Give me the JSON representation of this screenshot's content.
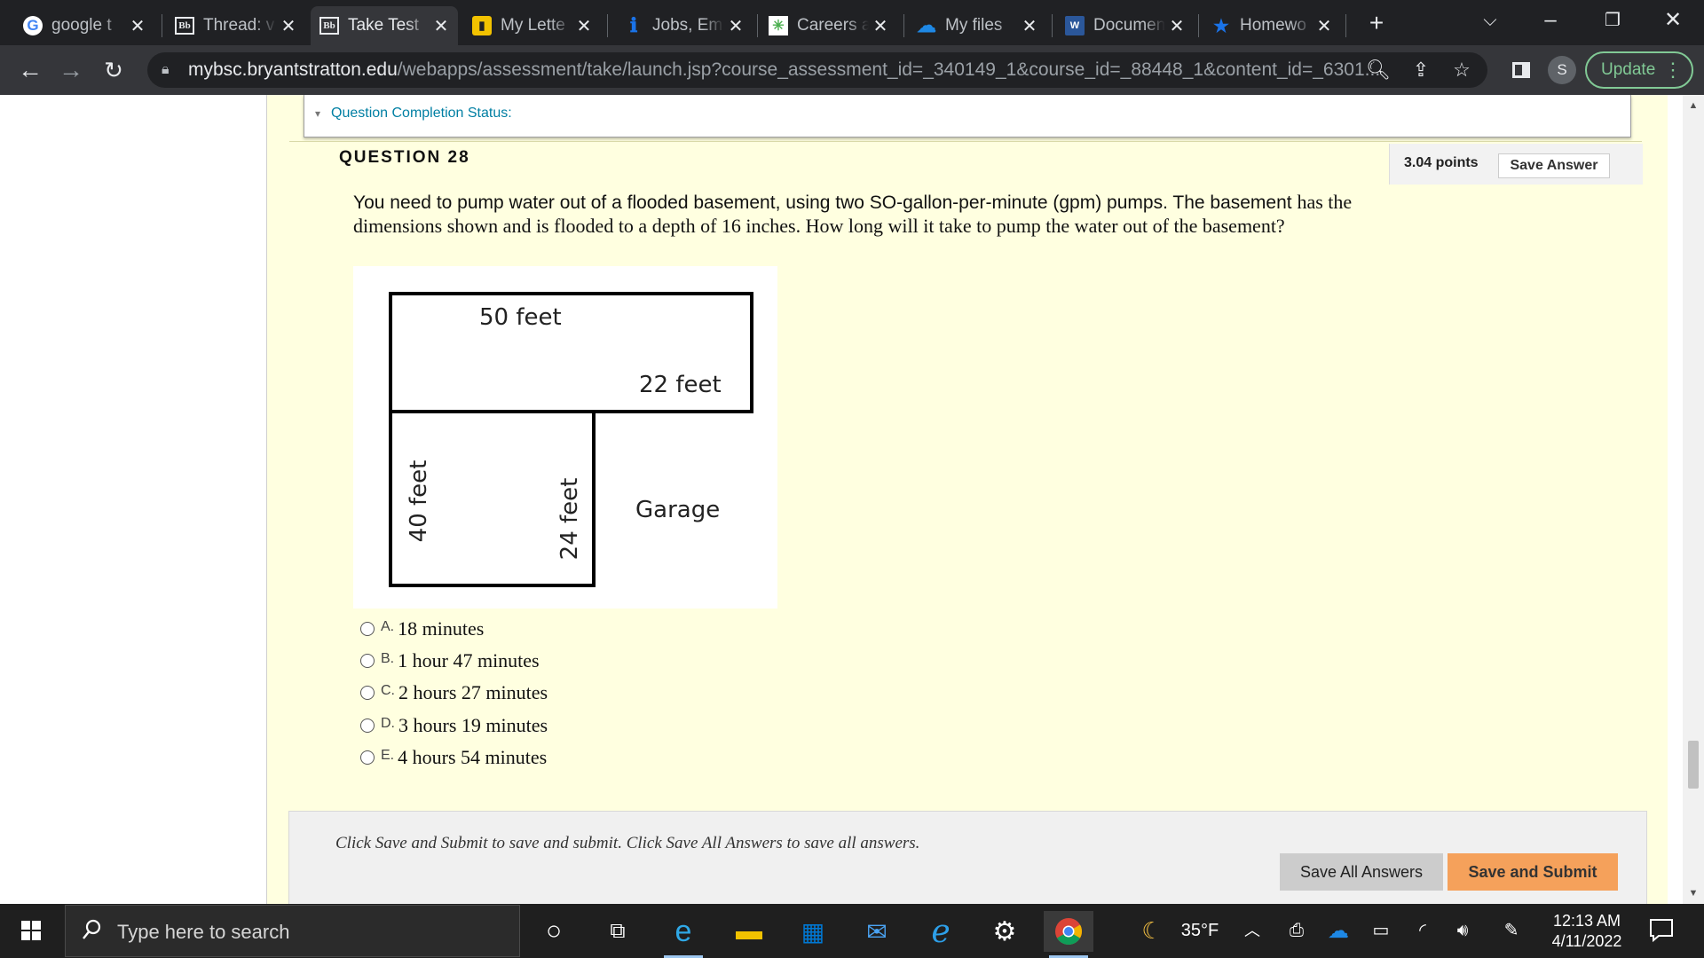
{
  "browser": {
    "tabs": [
      {
        "title": "google t",
        "favicon": "google-icon",
        "active": false
      },
      {
        "title": "Thread: v",
        "favicon": "blackboard-icon",
        "active": false
      },
      {
        "title": "Take Test",
        "favicon": "blackboard-icon",
        "active": true
      },
      {
        "title": "My Lette",
        "favicon": "document-icon",
        "active": false
      },
      {
        "title": "Jobs, Em",
        "favicon": "jobs-icon",
        "active": false
      },
      {
        "title": "Careers a",
        "favicon": "careers-icon",
        "active": false
      },
      {
        "title": "My files",
        "favicon": "onedrive-icon",
        "active": false
      },
      {
        "title": "Documen",
        "favicon": "word-icon",
        "active": false
      },
      {
        "title": "Homewo",
        "favicon": "star-icon",
        "active": false
      }
    ],
    "url_host": "mybsc.bryantstratton.edu",
    "url_path": "/webapps/assessment/take/launch.jsp?course_assessment_id=_340149_1&course_id=_88448_1&content_id=_6301...",
    "profile_initial": "S",
    "update_label": "Update"
  },
  "assessment": {
    "completion_status_label": "Question Completion Status:",
    "question_title": "QUESTION 28",
    "points": "3.04 points",
    "save_answer_label": "Save Answer",
    "question_text_sans": "You need to pump water out of a flooded basement, using two SO-gallon-per-minute (gpm) pumps. The basement",
    "question_text_serif": "has the dimensions shown and is flooded to a depth of 16 inches. How long will it take to pump the water out of the basement?",
    "diagram": {
      "label_top": "50 feet",
      "label_mid": "22 feet",
      "label_left": "40 feet",
      "label_inner": "24 feet",
      "label_garage": "Garage"
    },
    "choices": [
      {
        "letter": "A.",
        "text": "18 minutes"
      },
      {
        "letter": "B.",
        "text": "1 hour 47 minutes"
      },
      {
        "letter": "C.",
        "text": "2 hours 27 minutes"
      },
      {
        "letter": "D.",
        "text": "3 hours 19 minutes"
      },
      {
        "letter": "E.",
        "text": "4 hours 54 minutes"
      }
    ],
    "submit_hint": "Click Save and Submit to save and submit. Click Save All Answers to save all answers.",
    "save_all_label": "Save All Answers",
    "save_submit_label": "Save and Submit"
  },
  "taskbar": {
    "search_placeholder": "Type here to search",
    "weather": "35°F",
    "time": "12:13 AM",
    "date": "4/11/2022"
  },
  "colors": {
    "page_background": "#ffffe0",
    "submit_button": "#f5a15b",
    "link_teal": "#007fa3",
    "tab_strip": "#202124",
    "toolbar": "#35363a"
  }
}
